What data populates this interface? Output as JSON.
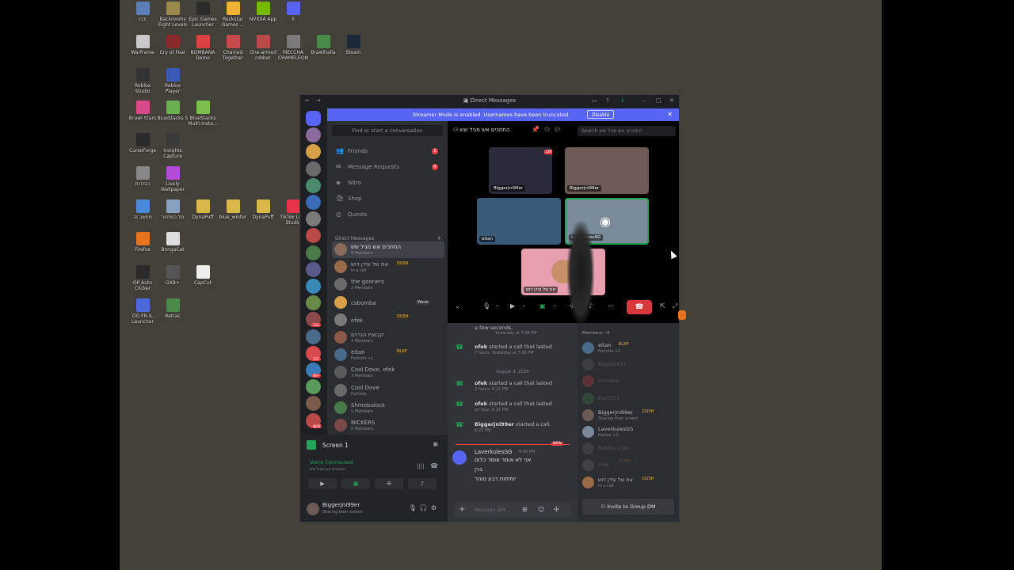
{
  "desktop": {
    "icons": [
      {
        "label": "ccc",
        "color": "#5b7fb8"
      },
      {
        "label": "Backrooms Eight Levels",
        "color": "#9a8a4a"
      },
      {
        "label": "Epic Games Launcher",
        "color": "#2a2a2a"
      },
      {
        "label": "Rockstar Games ...",
        "color": "#f0b232"
      },
      {
        "label": "NVIDIA App",
        "color": "#76b900"
      },
      {
        "label": "ii",
        "color": "#5865f2"
      },
      {
        "label": "Warframe",
        "color": "#c8c8c8"
      },
      {
        "label": "Cry of Fear",
        "color": "#8a2a2a"
      },
      {
        "label": "BOMBANA Demo",
        "color": "#d94040"
      },
      {
        "label": "Chained Together",
        "color": "#c84a4a"
      },
      {
        "label": "One-armed robber",
        "color": "#b84a4a"
      },
      {
        "label": "MECCHA CHAMELEON",
        "color": "#7a7a7a"
      },
      {
        "label": "Brawlhalla",
        "color": "#4a8a4a"
      },
      {
        "label": "Steam",
        "color": "#1b2838"
      },
      {
        "label": "Roblox Studio",
        "color": "#333333"
      },
      {
        "label": "Roblox Player",
        "color": "#3a5ab8"
      },
      {
        "label": "Brawl Stars",
        "color": "#d94a8a"
      },
      {
        "label": "BlueStacks 5",
        "color": "#6ab04c"
      },
      {
        "label": "BlueStacks Multi-Insta...",
        "color": "#7ac04c"
      },
      {
        "label": "CurseForge",
        "color": "#2a2a2a"
      },
      {
        "label": "Insights Capture",
        "color": "#3a3a3a"
      },
      {
        "label": "הגדרות",
        "color": "#888888"
      },
      {
        "label": "Lively Wallpaper",
        "color": "#b84ad9"
      },
      {
        "label": "מחשב זה",
        "color": "#4a8ad9"
      },
      {
        "label": "סל המחזור",
        "color": "#8aa0c0"
      },
      {
        "label": "DynaPuff",
        "color": "#d9b84a"
      },
      {
        "label": "blue_winter",
        "color": "#d9b84a"
      },
      {
        "label": "DynaPuff",
        "color": "#d9b84a"
      },
      {
        "label": "TikTok LIVE Studio",
        "color": "#e8334a"
      },
      {
        "label": "Firefox",
        "color": "#e8731e"
      },
      {
        "label": "BongoCat",
        "color": "#dddddd"
      },
      {
        "label": "OP Auto Clicker",
        "color": "#2a2a2a"
      },
      {
        "label": "GX8+",
        "color": "#555555"
      },
      {
        "label": "CapCut",
        "color": "#eeeeee"
      },
      {
        "label": "OG FN IL Launcher",
        "color": "#4a6ad9"
      },
      {
        "label": "Retrac",
        "color": "#4a8a4a"
      }
    ]
  },
  "window": {
    "title": "Direct Messages",
    "banner": {
      "text": "Streamer Mode is enabled. Usernames have been truncated.",
      "button": "Disable"
    }
  },
  "guild_badges": [
    "133",
    "232",
    "80+",
    "NEW"
  ],
  "dm_sidebar": {
    "search_placeholder": "Find or start a conversation",
    "nav": [
      {
        "label": "Friends",
        "icon": "👥",
        "badge": "2"
      },
      {
        "label": "Message Requests",
        "icon": "✉",
        "badge": "4"
      },
      {
        "label": "Nitro",
        "icon": "◈",
        "badge": ""
      },
      {
        "label": "Shop",
        "icon": "🛍",
        "badge": ""
      },
      {
        "label": "Quests",
        "icon": "◎",
        "badge": ""
      }
    ],
    "dm_header": "Direct Messages",
    "dms": [
      {
        "name": "התחכים אש מגיל שש",
        "sub": "9 Members",
        "tag": "",
        "color": "#8a6a5a",
        "active": true
      },
      {
        "name": "את של עידן דוש",
        "sub": "In a call",
        "tag": "DUSH",
        "color": "#9a6a4a",
        "active": false
      },
      {
        "name": "the gooners",
        "sub": "2 Members",
        "tag": "",
        "color": "#6a6a6a",
        "active": false
      },
      {
        "name": "csbomba",
        "sub": "",
        "tag": "Wave",
        "color": "#d9a04a",
        "active": false
      },
      {
        "name": "ofek",
        "sub": "",
        "tag": "DUSH",
        "color": "#7a7a7a",
        "active": false
      },
      {
        "name": "קבוצת הגרוים",
        "sub": "4 Members",
        "tag": "",
        "color": "#8a5a4a",
        "active": false
      },
      {
        "name": "eitan",
        "sub": "Fortnite +1",
        "tag": "BLXF",
        "color": "#4a6a8a",
        "active": false
      },
      {
        "name": "Cool Dove, ofek",
        "sub": "3 Members",
        "tag": "",
        "color": "#5a5a5a",
        "active": false
      },
      {
        "name": "Cool Dove",
        "sub": "Fortnite",
        "tag": "",
        "color": "#6a6a6a",
        "active": false
      },
      {
        "name": "Shmebulock",
        "sub": "5 Members",
        "tag": "",
        "color": "#4a7a4a",
        "active": false
      },
      {
        "name": "NICKERS",
        "sub": "5 Members",
        "tag": "",
        "color": "#7a4a4a",
        "active": false
      }
    ]
  },
  "panel": {
    "screen_label": "Screen 1",
    "voice_status": "Voice Connected",
    "voice_channel": "התחכים אש מגיל שש",
    "user_name": "Biggerjni99er",
    "user_status": "Sharing their screen"
  },
  "call": {
    "title": "התחכים אש מגיל שש",
    "search_placeholder": "Search התחכים אש מגיל שש",
    "live_badge": "LIVE",
    "tiles": [
      {
        "label": "Biggerjni99er",
        "color": "#2a2a3a"
      },
      {
        "label": "Biggerjni99er",
        "color": "#6b5a55"
      },
      {
        "label": "eitan",
        "color": "#3a5a7a"
      },
      {
        "label": "LaverkulesSG",
        "color": "#7a8a9a"
      },
      {
        "label": "את של עידן דוש",
        "color": "#e8a0b0"
      }
    ]
  },
  "chat": {
    "date_separator": "August 3, 2026",
    "lines": [
      {
        "name": "",
        "text": "a few seconds.",
        "time": "Yesterday at 7:08 PM"
      },
      {
        "name": "ofek",
        "text": " started a call that lasted",
        "time": "7 hours. Yesterday at 7:09 PM"
      },
      {
        "name": "ofek",
        "text": " started a call that lasted",
        "time": "2 hours. 6:21 PM"
      },
      {
        "name": "ofek",
        "text": " started a call that lasted",
        "time": "an hour. 6:21 PM"
      },
      {
        "name": "Biggerjni99er",
        "text": " started a call.",
        "time": "8:22 PM"
      }
    ],
    "new_label": "NEW",
    "message": {
      "author": "LaverkulesSG",
      "time": "8:48 PM",
      "lines": [
        "אני לא אומר אומר כלום",
        "ברן",
        "יותיחות דבע טוהר"
      ]
    },
    "input_placeholder": "Message @H..."
  },
  "members": {
    "header": "Members—9",
    "list": [
      {
        "name": "eitan",
        "sub": "Fortnite +1",
        "tag": "BLXF",
        "color": "#4a6a8a",
        "dim": false
      },
      {
        "name": "Blaster473",
        "sub": "",
        "tag": "",
        "color": "#6a6a6a",
        "dim": true
      },
      {
        "name": "Invisible",
        "sub": "",
        "tag": "",
        "color": "#d94040",
        "dim": true
      },
      {
        "name": "ExclCO1",
        "sub": "",
        "tag": "",
        "color": "#4a8a4a",
        "dim": true
      },
      {
        "name": "Biggerjni99er",
        "sub": "Sharing their screen",
        "tag": "DUSH",
        "color": "#6b5b55",
        "dim": false
      },
      {
        "name": "LaverkulesSG",
        "sub": "Roblox +1",
        "tag": "",
        "color": "#7a8a9a",
        "dim": false
      },
      {
        "name": "Roblox_Clan",
        "sub": "",
        "tag": "",
        "color": "#6a6a6a",
        "dim": true
      },
      {
        "name": "ofek",
        "sub": "",
        "tag": "DUSH",
        "color": "#7a7a7a",
        "dim": true
      },
      {
        "name": "את של עידן דוש",
        "sub": "In a call",
        "tag": "DUSH",
        "color": "#9a6a4a",
        "dim": false
      }
    ],
    "invite_button": "Invite to Group DM"
  }
}
